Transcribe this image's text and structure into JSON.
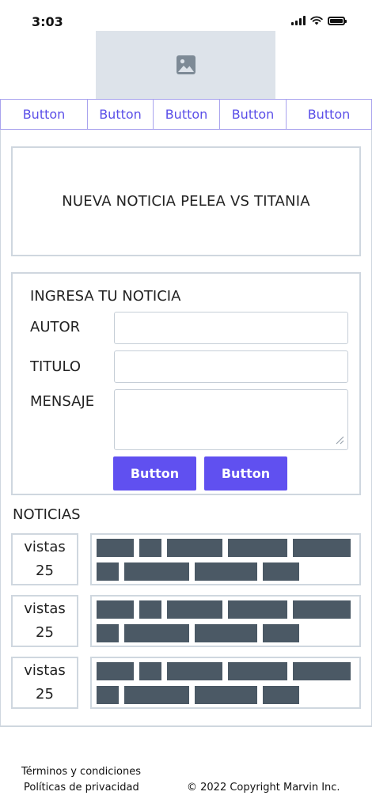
{
  "status_bar": {
    "time": "3:03"
  },
  "tabs": [
    {
      "label": "Button"
    },
    {
      "label": "Button"
    },
    {
      "label": "Button"
    },
    {
      "label": "Button"
    },
    {
      "label": "Button"
    }
  ],
  "headline": {
    "text": "NUEVA NOTICIA PELEA VS TITANIA"
  },
  "form": {
    "title": "INGRESA TU NOTICIA",
    "author_label": "AUTOR",
    "author_value": "",
    "title_label": "TITULO",
    "title_value": "",
    "message_label": "MENSAJE",
    "message_value": "",
    "submit_label": "Button",
    "secondary_label": "Button"
  },
  "news": {
    "heading": "NOTICIAS",
    "items": [
      {
        "views_label": "vistas",
        "views_count": "25"
      },
      {
        "views_label": "vistas",
        "views_count": "25"
      },
      {
        "views_label": "vistas",
        "views_count": "25"
      }
    ]
  },
  "footer": {
    "terms": "Términos y condiciones",
    "privacy": "Políticas de privacidad",
    "copyright": "© 2022 Copyright Marvin Inc."
  },
  "colors": {
    "accent": "#6050f0",
    "tab_text": "#5b4fe8",
    "border": "#cfd7df",
    "placeholder_bar": "#4b5965",
    "image_placeholder": "#dde3ea"
  },
  "icons": {
    "image_placeholder": "image-icon",
    "signal": "signal-icon",
    "wifi": "wifi-icon",
    "battery": "battery-icon",
    "resize": "resize-grip-icon"
  }
}
